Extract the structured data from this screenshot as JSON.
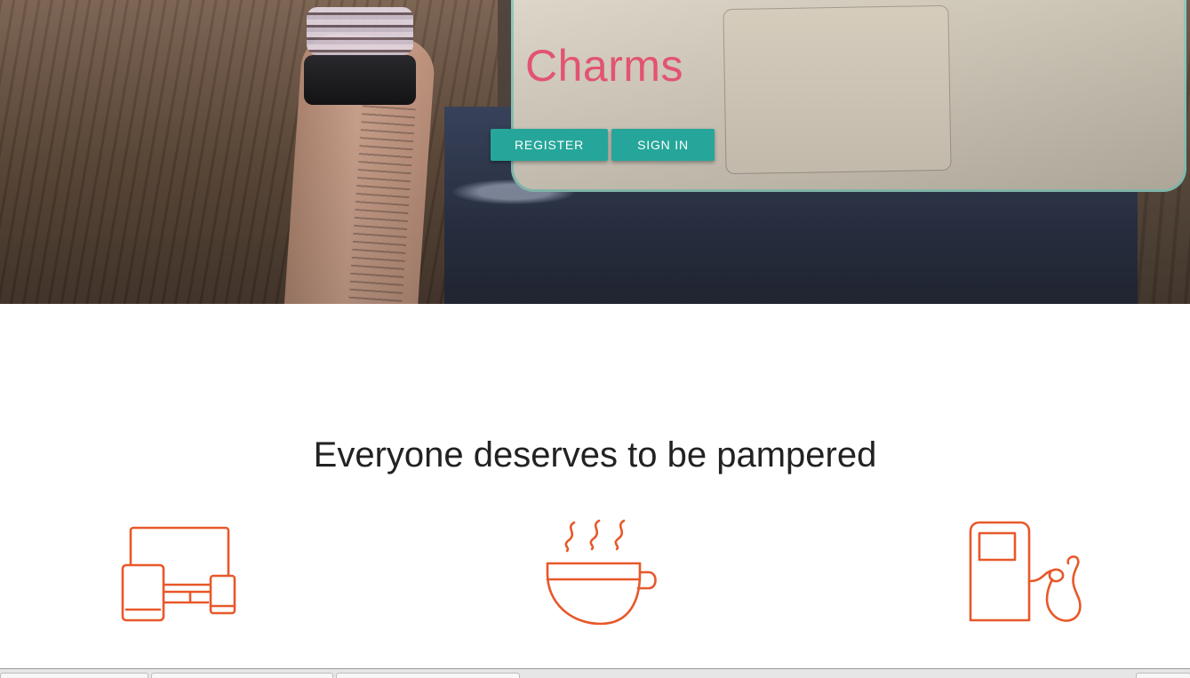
{
  "hero": {
    "brand": "Charms",
    "buttons": {
      "register_label": "REGISTER",
      "signin_label": "SIGN IN"
    }
  },
  "features": {
    "tagline": "Everyone deserves to be pampered",
    "icons": [
      "devices-icon",
      "coffee-cup-icon",
      "fuel-pump-icon"
    ]
  },
  "colors": {
    "brand": "#e25471",
    "button": "#26a69a",
    "icon_stroke": "#e8582a",
    "tagline_text": "#222222"
  }
}
